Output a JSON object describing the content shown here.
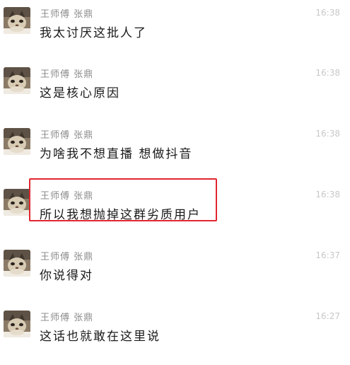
{
  "messages": [
    {
      "sender": "王师傅 张鼎",
      "time": "16:38",
      "text": "我太讨厌这批人了"
    },
    {
      "sender": "王师傅 张鼎",
      "time": "16:38",
      "text": "这是核心原因"
    },
    {
      "sender": "王师傅 张鼎",
      "time": "16:38",
      "text": "为啥我不想直播 想做抖音"
    },
    {
      "sender": "王师傅 张鼎",
      "time": "16:38",
      "text": "所以我想抛掉这群劣质用户"
    },
    {
      "sender": "王师傅 张鼎",
      "time": "16:37",
      "text": "你说得对"
    },
    {
      "sender": "王师傅 张鼎",
      "time": "16:27",
      "text": "这话也就敢在这里说"
    }
  ],
  "colors": {
    "highlight": "#e0262f",
    "sender": "#8c8c8c",
    "time": "#c8c8c8",
    "text": "#1a1a1a"
  },
  "icons": {
    "avatar": "cat-avatar-icon"
  }
}
